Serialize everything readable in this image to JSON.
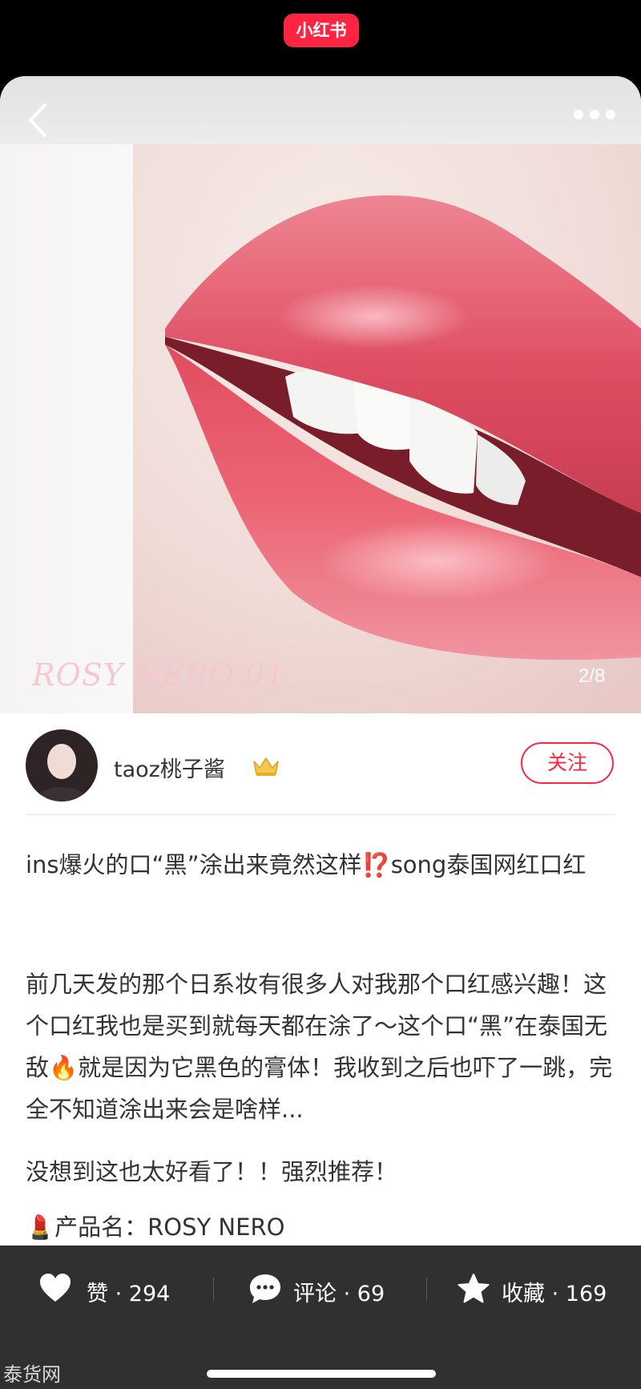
{
  "app": {
    "logo_text": "小红书"
  },
  "image": {
    "caption": "ROSY NERO 01",
    "page_indicator": "2/8"
  },
  "author": {
    "name": "taoz桃子酱",
    "follow_label": "关注"
  },
  "post": {
    "title": "ins爆火的口“黑”涂出来竟然这样⁉️song泰国网红口红",
    "body_1": "前几天发的那个日系妆有很多人对我那个口红感兴趣！这个口红我也是买到就每天都在涂了～这个口“黑”在泰国无敌🔥就是因为它黑色的膏体！我收到之后也吓了一跳，完全不知道涂出来会是啥样...",
    "body_2": "没想到这也太好看了！！强烈推荐！",
    "body_3": "💄产品名：ROSY NERO"
  },
  "actions": {
    "like": {
      "label": "赞",
      "count": "294"
    },
    "comment": {
      "label": "评论",
      "count": "69"
    },
    "collect": {
      "label": "收藏",
      "count": "169"
    },
    "separator": "·"
  },
  "watermark": "泰货网",
  "colors": {
    "brand": "#ff2442",
    "bottom_bar": "#303030",
    "lip": "#e24d61"
  }
}
